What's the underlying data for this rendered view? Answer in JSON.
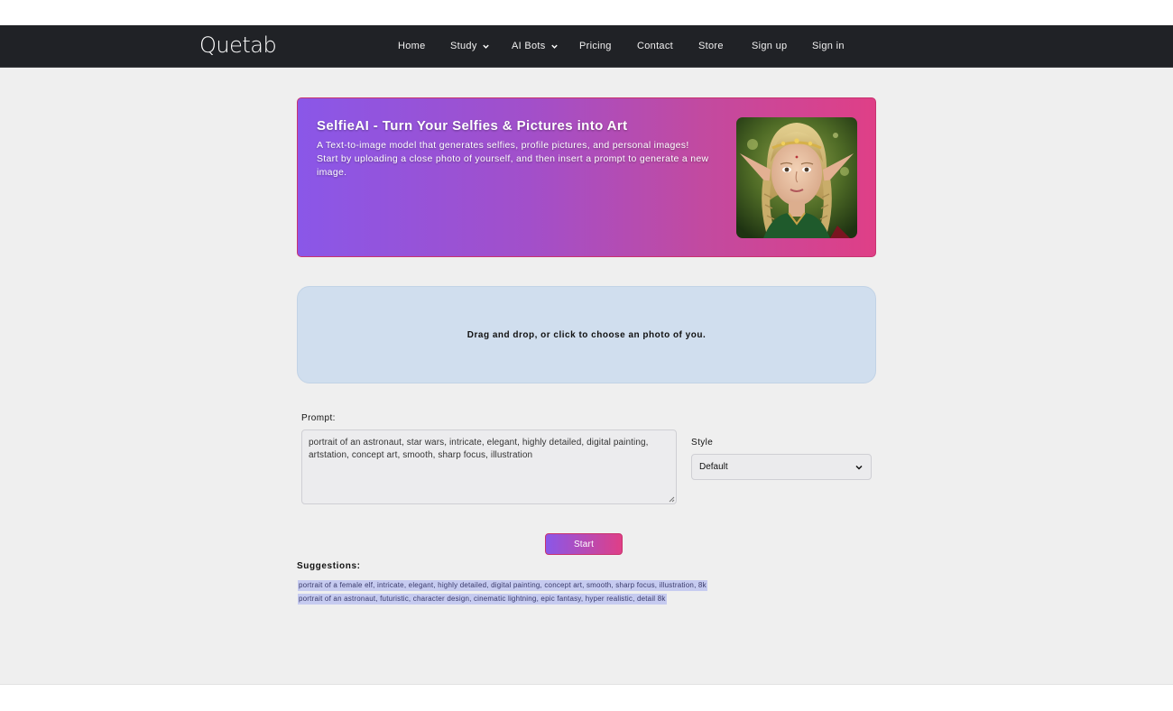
{
  "brand": {
    "logo": "Quetab"
  },
  "nav": {
    "items": [
      {
        "label": "Home"
      },
      {
        "label": "Study",
        "has_dropdown": true
      },
      {
        "label": "AI Bots",
        "has_dropdown": true
      },
      {
        "label": "Pricing"
      },
      {
        "label": "Contact"
      },
      {
        "label": "Store"
      },
      {
        "label": "Sign up"
      },
      {
        "label": "Sign in"
      }
    ]
  },
  "hero": {
    "title": "SelfieAI - Turn Your Selfies & Pictures into Art",
    "desc_line1": "A Text-to-image model that generates selfies, profile pictures, and personal images!",
    "desc_line2": "Start by uploading a close photo of yourself, and then insert a prompt to generate a new image.",
    "gradient_start": "#8a57e8",
    "gradient_end": "#df3f87",
    "image_icon": "elf-portrait-image"
  },
  "upload": {
    "text": "Drag and drop, or click to choose an photo of you."
  },
  "prompt": {
    "label": "Prompt:",
    "value": "portrait of an astronaut, star wars, intricate, elegant, highly detailed, digital painting, artstation, concept art, smooth, sharp focus, illustration"
  },
  "style": {
    "label": "Style",
    "selected": "Default"
  },
  "start_button": {
    "label": "Start"
  },
  "suggestions": {
    "label": "Suggestions:",
    "items": [
      "portrait of a female elf, intricate, elegant, highly detailed, digital painting, concept art, smooth, sharp focus, illustration, 8k",
      "portrait of an astronaut, futuristic, character design, cinematic lightning, epic fantasy, hyper realistic, detail 8k"
    ]
  },
  "colors": {
    "navbar_bg": "#202226",
    "page_bg": "#efefef",
    "dropzone_bg": "#d0deee",
    "suggestion_highlight": "#c6cbf0"
  }
}
